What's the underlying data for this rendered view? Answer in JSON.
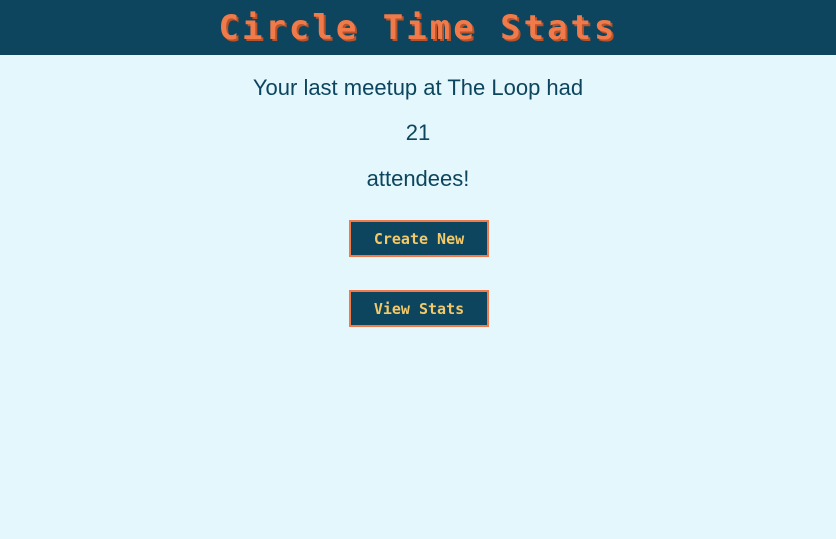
{
  "header": {
    "title": "Circle Time Stats"
  },
  "main": {
    "line1": "Your last meetup at The Loop had",
    "attendee_count": "21",
    "line3": "attendees!"
  },
  "buttons": {
    "create_label": "Create New",
    "view_label": "View Stats"
  },
  "colors": {
    "header_bg": "#0c455d",
    "accent": "#f07a4a",
    "button_text": "#f3c96a",
    "page_bg": "#e3f7fd",
    "text": "#0c455d"
  }
}
